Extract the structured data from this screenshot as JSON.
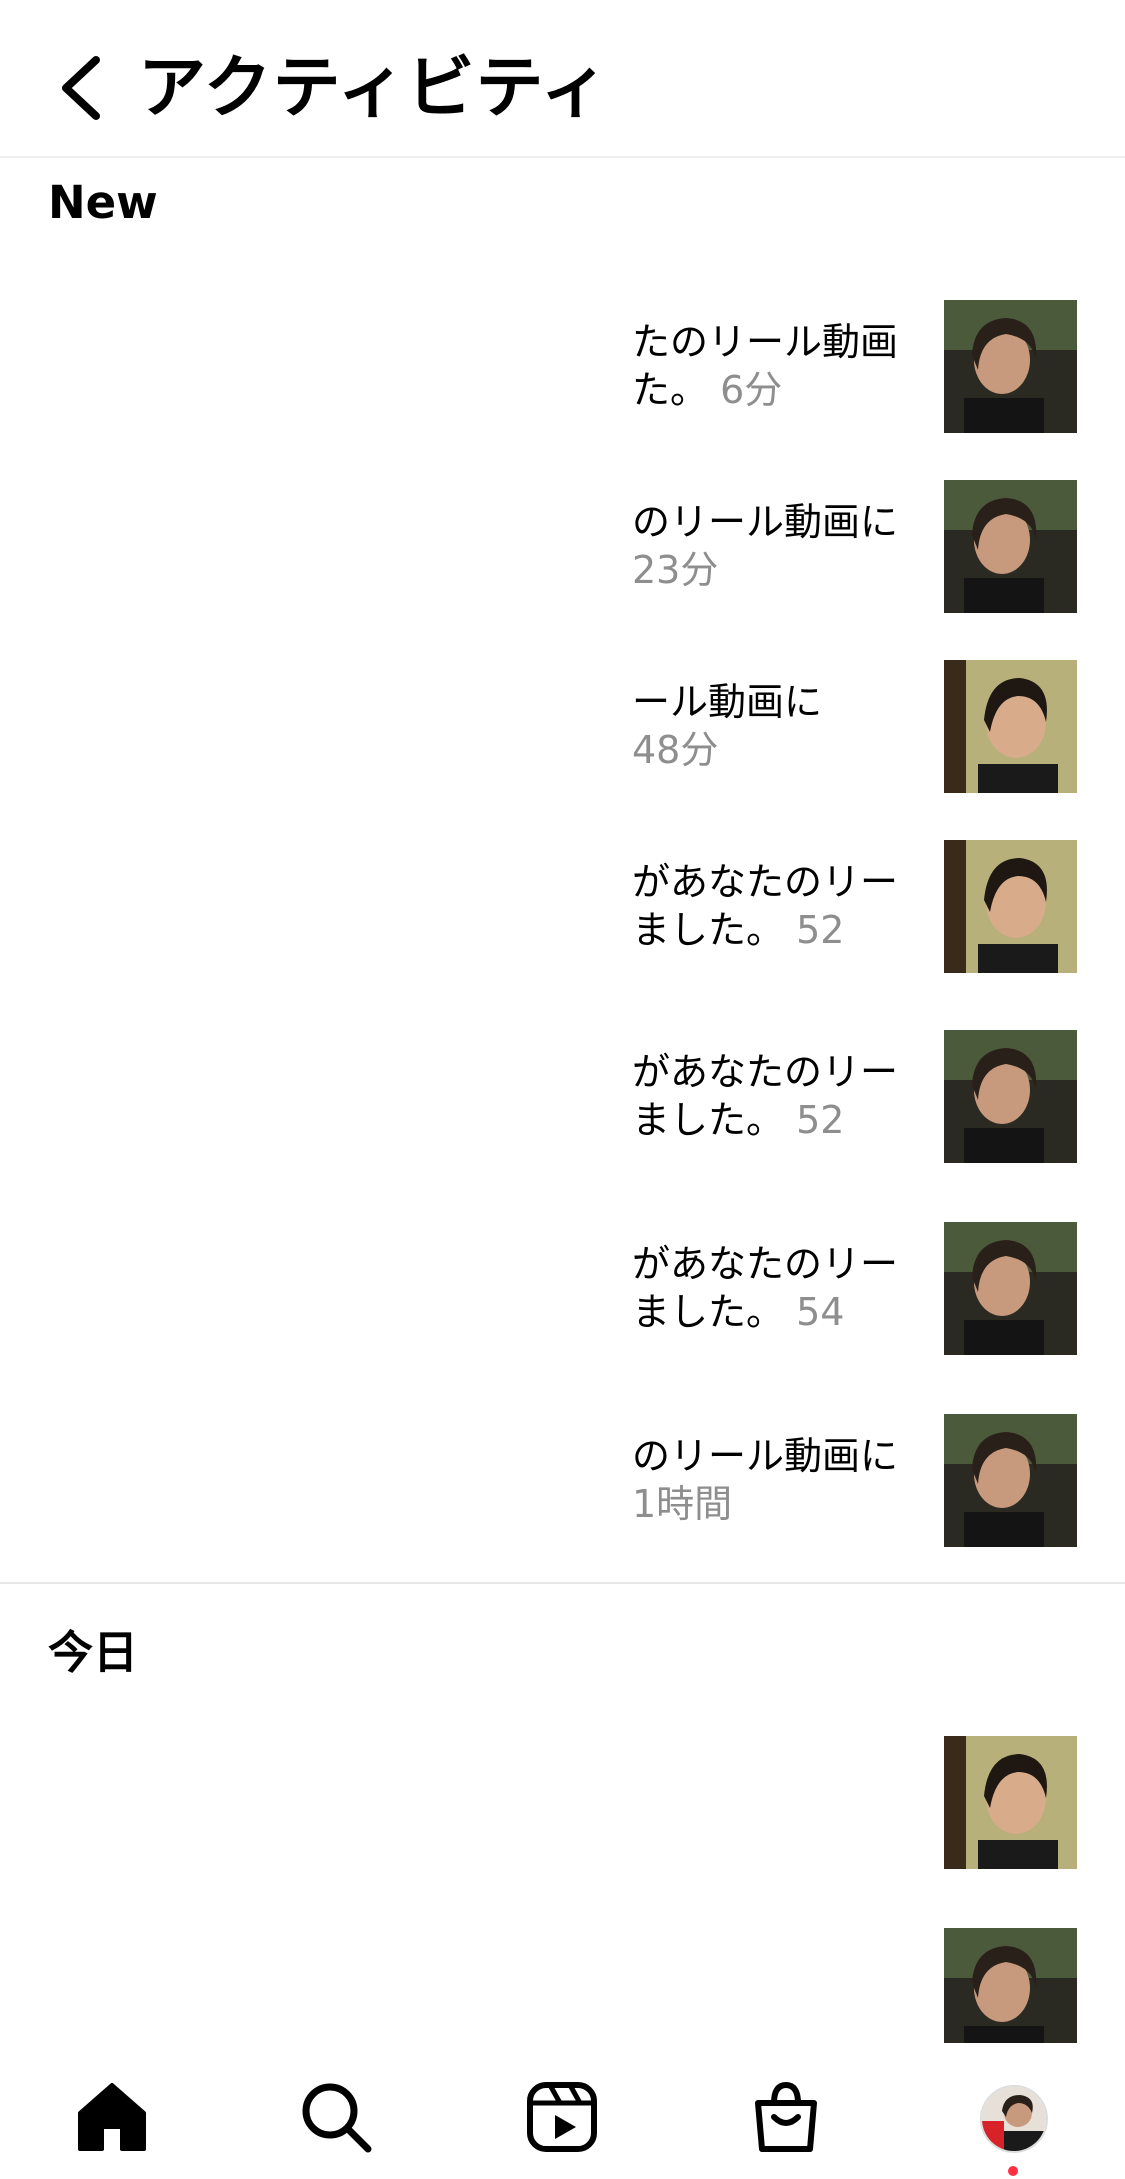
{
  "header": {
    "title": "アクティビティ"
  },
  "sections": {
    "new_label": "New",
    "today_label": "今日"
  },
  "new_items": [
    {
      "line1": "たのリール動画",
      "line2_prefix": "た。",
      "time": "6分"
    },
    {
      "line1": "のリール動画に",
      "line2_prefix": "",
      "time": "23分"
    },
    {
      "line1": "ール動画に",
      "line2_prefix": "",
      "time": "48分"
    },
    {
      "line1": "があなたのリー",
      "line2_prefix": "ました。",
      "time": "52"
    },
    {
      "line1": "があなたのリー",
      "line2_prefix": "ました。",
      "time": "52"
    },
    {
      "line1": "があなたのリー",
      "line2_prefix": "ました。",
      "time": "54"
    },
    {
      "line1": "のリール動画に",
      "line2_prefix": "",
      "time": "1時間"
    }
  ],
  "tabs": [
    "home-icon",
    "search-icon",
    "reels-icon",
    "shop-icon",
    "profile-avatar"
  ],
  "colors": {
    "divider": "#e8e8e8",
    "secondary_text": "#8e8e8e",
    "notification": "#ff3040"
  }
}
